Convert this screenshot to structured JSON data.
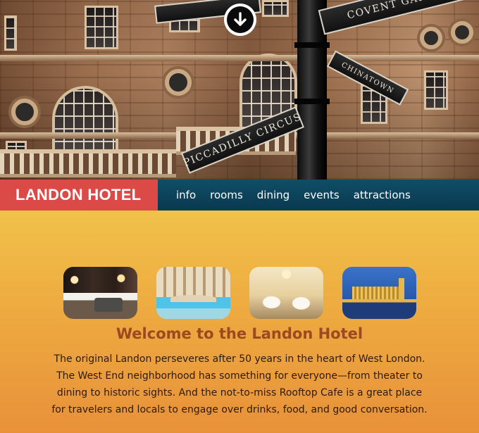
{
  "hero": {
    "signs": [
      "COVENT GARDEN",
      "PICCADILLY CIRCUS",
      "CHINATOWN"
    ],
    "scroll_icon": "arrow-down-circle-icon"
  },
  "nav": {
    "brand": "LANDON HOTEL",
    "links": [
      "info",
      "rooms",
      "dining",
      "events",
      "attractions"
    ],
    "colors": {
      "brand_bg": "#dc4a48",
      "bar_bg": "#0f4e66"
    }
  },
  "main": {
    "thumbnails": [
      "hotel-room-photo",
      "indoor-pool-photo",
      "dining-room-photo",
      "parliament-photo"
    ],
    "title": "Welcome to the Landon Hotel",
    "intro": "The original Landon perseveres after 50 years in the heart of West London. The West End neighborhood has something for everyone—from theater to dining to historic sights. And the not-to-miss Rooftop Cafe is a great place for travelers and locals to engage over drinks, food, and good conversation.",
    "colors": {
      "title": "#9a4a22",
      "bg_top": "#f1c24a",
      "bg_bottom": "#e8913a"
    }
  }
}
